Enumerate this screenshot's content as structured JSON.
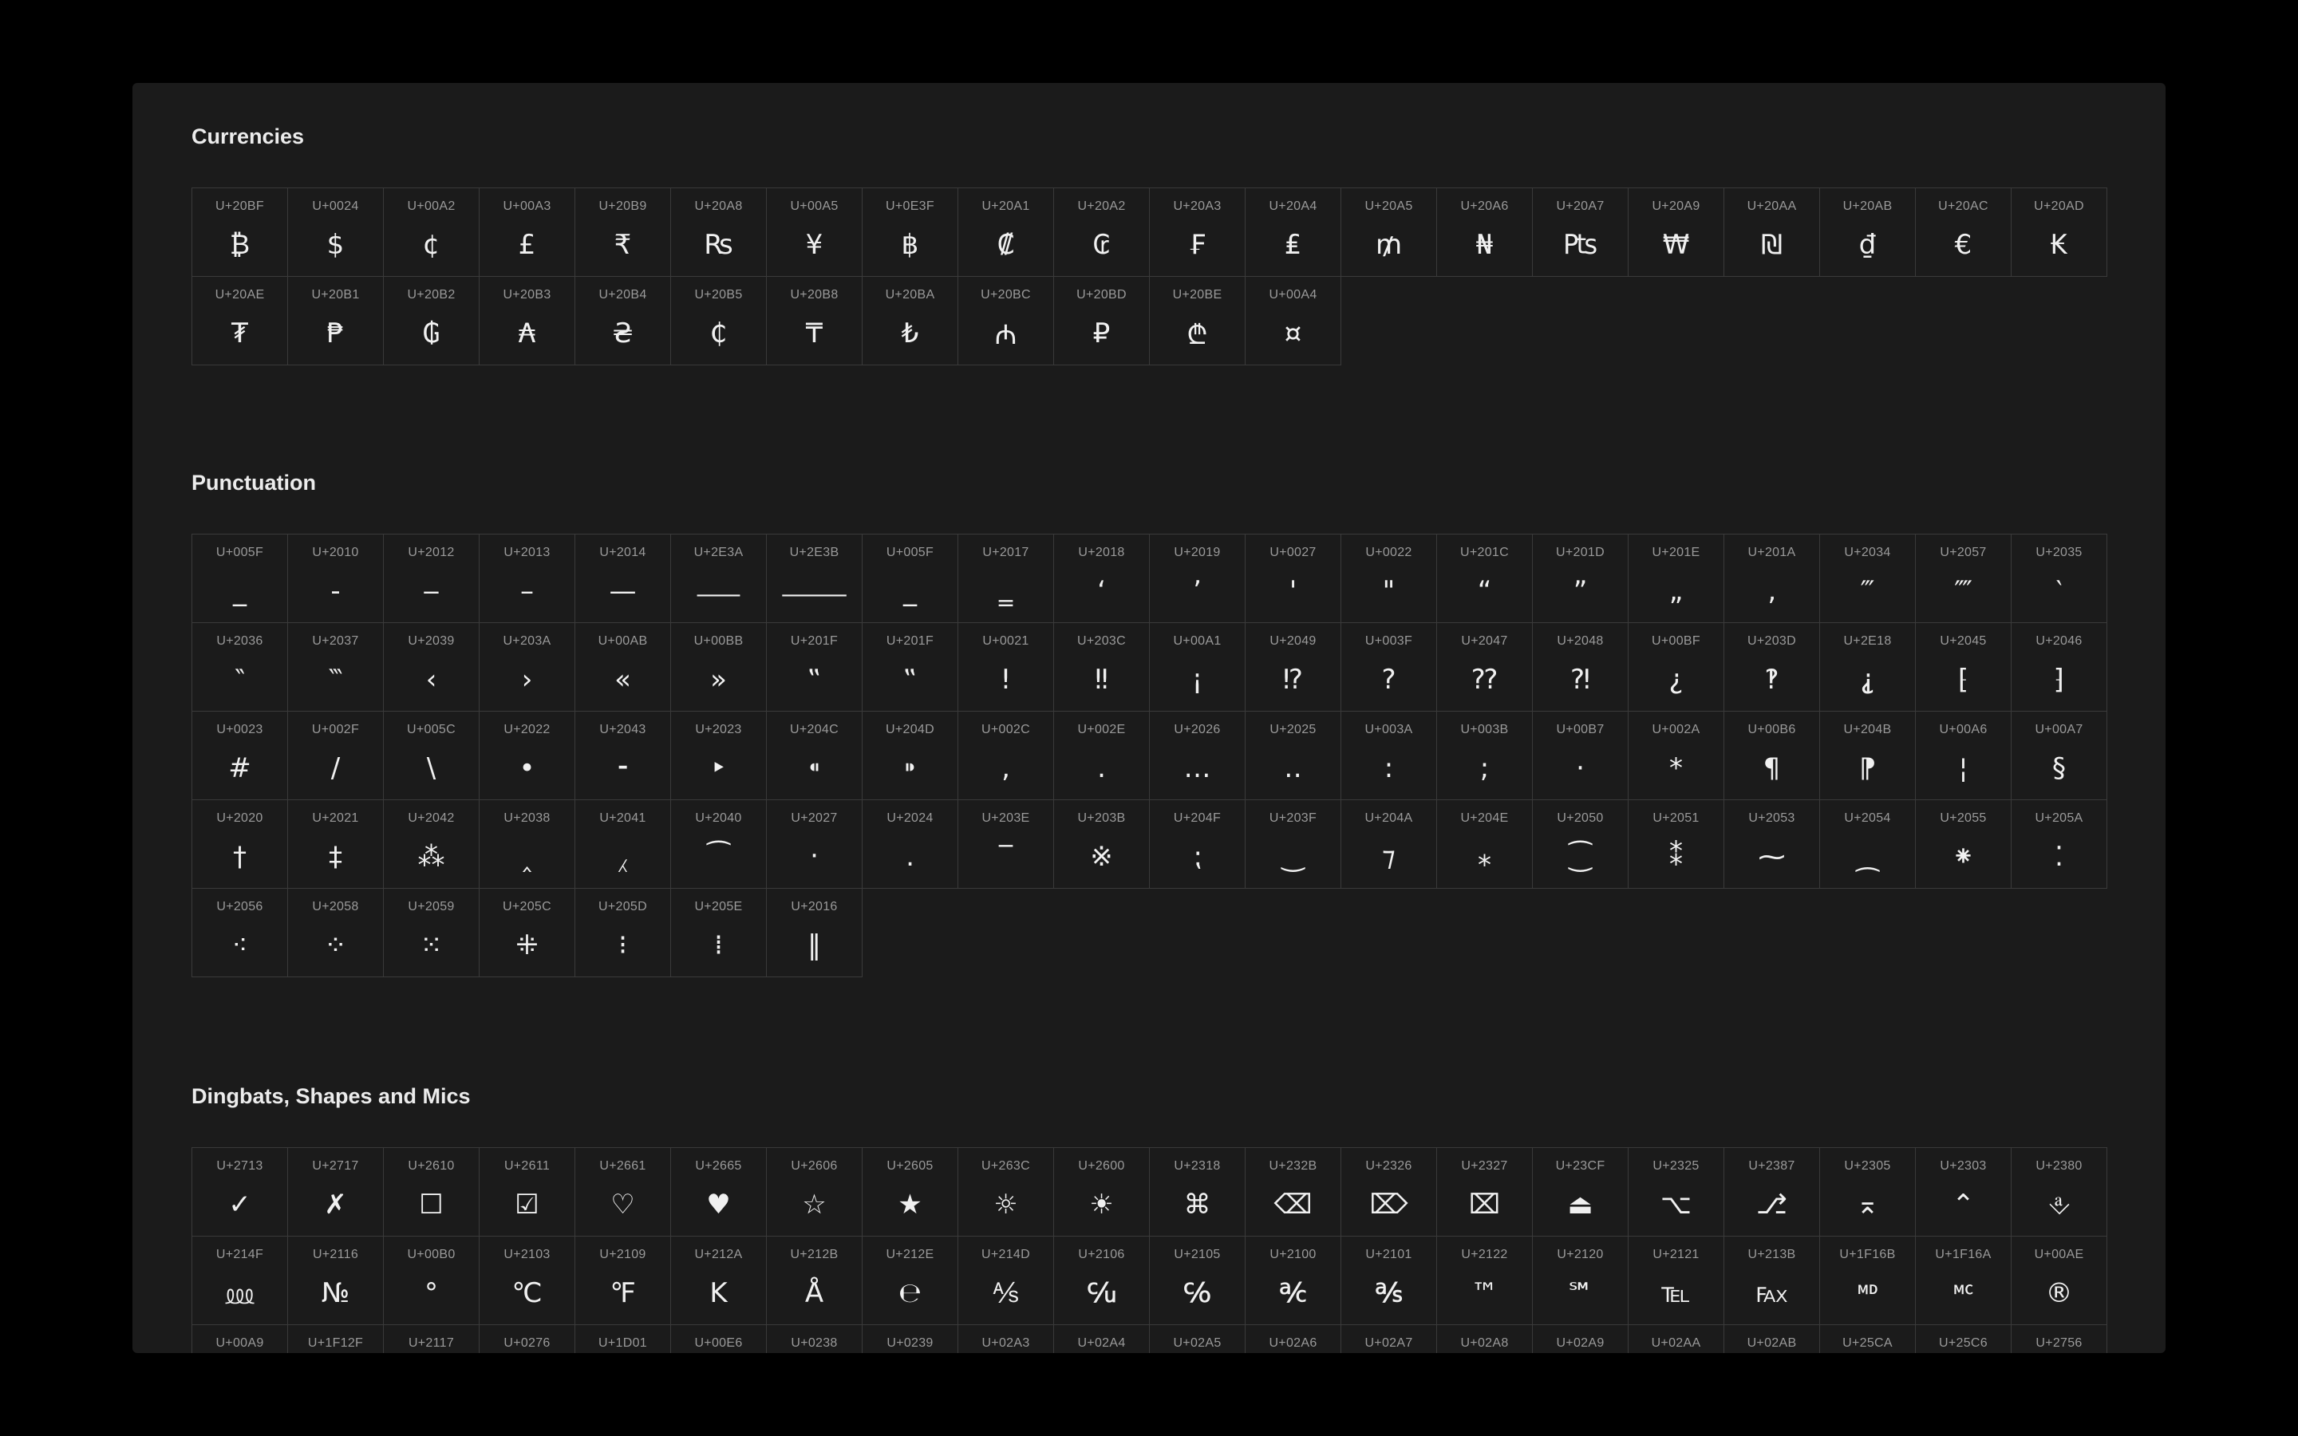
{
  "sections": [
    {
      "title": "Currencies",
      "glyphs": [
        {
          "code": "U+20BF",
          "char": "₿"
        },
        {
          "code": "U+0024",
          "char": "$"
        },
        {
          "code": "U+00A2",
          "char": "¢"
        },
        {
          "code": "U+00A3",
          "char": "£"
        },
        {
          "code": "U+20B9",
          "char": "₹"
        },
        {
          "code": "U+20A8",
          "char": "₨"
        },
        {
          "code": "U+00A5",
          "char": "¥"
        },
        {
          "code": "U+0E3F",
          "char": "฿"
        },
        {
          "code": "U+20A1",
          "char": "₡"
        },
        {
          "code": "U+20A2",
          "char": "₢"
        },
        {
          "code": "U+20A3",
          "char": "₣"
        },
        {
          "code": "U+20A4",
          "char": "₤"
        },
        {
          "code": "U+20A5",
          "char": "₥"
        },
        {
          "code": "U+20A6",
          "char": "₦"
        },
        {
          "code": "U+20A7",
          "char": "₧"
        },
        {
          "code": "U+20A9",
          "char": "₩"
        },
        {
          "code": "U+20AA",
          "char": "₪"
        },
        {
          "code": "U+20AB",
          "char": "₫"
        },
        {
          "code": "U+20AC",
          "char": "€"
        },
        {
          "code": "U+20AD",
          "char": "₭"
        },
        {
          "code": "U+20AE",
          "char": "₮"
        },
        {
          "code": "U+20B1",
          "char": "₱"
        },
        {
          "code": "U+20B2",
          "char": "₲"
        },
        {
          "code": "U+20B3",
          "char": "₳"
        },
        {
          "code": "U+20B4",
          "char": "₴"
        },
        {
          "code": "U+20B5",
          "char": "₵"
        },
        {
          "code": "U+20B8",
          "char": "₸"
        },
        {
          "code": "U+20BA",
          "char": "₺"
        },
        {
          "code": "U+20BC",
          "char": "₼"
        },
        {
          "code": "U+20BD",
          "char": "₽"
        },
        {
          "code": "U+20BE",
          "char": "₾"
        },
        {
          "code": "U+00A4",
          "char": "¤"
        }
      ]
    },
    {
      "title": "Punctuation",
      "glyphs": [
        {
          "code": "U+005F",
          "char": "_"
        },
        {
          "code": "U+2010",
          "char": "‐"
        },
        {
          "code": "U+2012",
          "char": "‒"
        },
        {
          "code": "U+2013",
          "char": "–"
        },
        {
          "code": "U+2014",
          "char": "—"
        },
        {
          "code": "U+2E3A",
          "char": "⸺"
        },
        {
          "code": "U+2E3B",
          "char": "⸻"
        },
        {
          "code": "U+005F",
          "char": "_"
        },
        {
          "code": "U+2017",
          "char": "‗"
        },
        {
          "code": "U+2018",
          "char": "‘"
        },
        {
          "code": "U+2019",
          "char": "’"
        },
        {
          "code": "U+0027",
          "char": "'"
        },
        {
          "code": "U+0022",
          "char": "\""
        },
        {
          "code": "U+201C",
          "char": "“"
        },
        {
          "code": "U+201D",
          "char": "”"
        },
        {
          "code": "U+201E",
          "char": "„"
        },
        {
          "code": "U+201A",
          "char": "‚"
        },
        {
          "code": "U+2034",
          "char": "‴"
        },
        {
          "code": "U+2057",
          "char": "⁗"
        },
        {
          "code": "U+2035",
          "char": "‵"
        },
        {
          "code": "U+2036",
          "char": "‶"
        },
        {
          "code": "U+2037",
          "char": "‷"
        },
        {
          "code": "U+2039",
          "char": "‹"
        },
        {
          "code": "U+203A",
          "char": "›"
        },
        {
          "code": "U+00AB",
          "char": "«"
        },
        {
          "code": "U+00BB",
          "char": "»"
        },
        {
          "code": "U+201F",
          "char": "‟"
        },
        {
          "code": "U+201F",
          "char": "‟"
        },
        {
          "code": "U+0021",
          "char": "!"
        },
        {
          "code": "U+203C",
          "char": "‼"
        },
        {
          "code": "U+00A1",
          "char": "¡"
        },
        {
          "code": "U+2049",
          "char": "⁉"
        },
        {
          "code": "U+003F",
          "char": "?"
        },
        {
          "code": "U+2047",
          "char": "⁇"
        },
        {
          "code": "U+2048",
          "char": "⁈"
        },
        {
          "code": "U+00BF",
          "char": "¿"
        },
        {
          "code": "U+203D",
          "char": "‽"
        },
        {
          "code": "U+2E18",
          "char": "⸘"
        },
        {
          "code": "U+2045",
          "char": "⁅"
        },
        {
          "code": "U+2046",
          "char": "⁆"
        },
        {
          "code": "U+0023",
          "char": "#"
        },
        {
          "code": "U+002F",
          "char": "/"
        },
        {
          "code": "U+005C",
          "char": "\\"
        },
        {
          "code": "U+2022",
          "char": "•"
        },
        {
          "code": "U+2043",
          "char": "⁃"
        },
        {
          "code": "U+2023",
          "char": "‣"
        },
        {
          "code": "U+204C",
          "char": "⁌"
        },
        {
          "code": "U+204D",
          "char": "⁍"
        },
        {
          "code": "U+002C",
          "char": ","
        },
        {
          "code": "U+002E",
          "char": "."
        },
        {
          "code": "U+2026",
          "char": "…"
        },
        {
          "code": "U+2025",
          "char": "‥"
        },
        {
          "code": "U+003A",
          "char": ":"
        },
        {
          "code": "U+003B",
          "char": ";"
        },
        {
          "code": "U+00B7",
          "char": "·"
        },
        {
          "code": "U+002A",
          "char": "*"
        },
        {
          "code": "U+00B6",
          "char": "¶"
        },
        {
          "code": "U+204B",
          "char": "⁋"
        },
        {
          "code": "U+00A6",
          "char": "¦"
        },
        {
          "code": "U+00A7",
          "char": "§"
        },
        {
          "code": "U+2020",
          "char": "†"
        },
        {
          "code": "U+2021",
          "char": "‡"
        },
        {
          "code": "U+2042",
          "char": "⁂"
        },
        {
          "code": "U+2038",
          "char": "‸"
        },
        {
          "code": "U+2041",
          "char": "⁁"
        },
        {
          "code": "U+2040",
          "char": "⁀"
        },
        {
          "code": "U+2027",
          "char": "‧"
        },
        {
          "code": "U+2024",
          "char": "․"
        },
        {
          "code": "U+203E",
          "char": "‾"
        },
        {
          "code": "U+203B",
          "char": "※"
        },
        {
          "code": "U+204F",
          "char": "⁏"
        },
        {
          "code": "U+203F",
          "char": "‿"
        },
        {
          "code": "U+204A",
          "char": "⁊"
        },
        {
          "code": "U+204E",
          "char": "⁎"
        },
        {
          "code": "U+2050",
          "char": "⁐"
        },
        {
          "code": "U+2051",
          "char": "⁑"
        },
        {
          "code": "U+2053",
          "char": "⁓"
        },
        {
          "code": "U+2054",
          "char": "⁔"
        },
        {
          "code": "U+2055",
          "char": "⁕"
        },
        {
          "code": "U+205A",
          "char": "⁚"
        },
        {
          "code": "U+2056",
          "char": "⁖"
        },
        {
          "code": "U+2058",
          "char": "⁘"
        },
        {
          "code": "U+2059",
          "char": "⁙"
        },
        {
          "code": "U+205C",
          "char": "⁜"
        },
        {
          "code": "U+205D",
          "char": "⁝"
        },
        {
          "code": "U+205E",
          "char": "⁞"
        },
        {
          "code": "U+2016",
          "char": "‖"
        }
      ]
    },
    {
      "title": "Dingbats, Shapes and Mics",
      "glyphs": [
        {
          "code": "U+2713",
          "char": "✓"
        },
        {
          "code": "U+2717",
          "char": "✗"
        },
        {
          "code": "U+2610",
          "char": "☐"
        },
        {
          "code": "U+2611",
          "char": "☑"
        },
        {
          "code": "U+2661",
          "char": "♡"
        },
        {
          "code": "U+2665",
          "char": "♥"
        },
        {
          "code": "U+2606",
          "char": "☆"
        },
        {
          "code": "U+2605",
          "char": "★"
        },
        {
          "code": "U+263C",
          "char": "☼"
        },
        {
          "code": "U+2600",
          "char": "☀"
        },
        {
          "code": "U+2318",
          "char": "⌘"
        },
        {
          "code": "U+232B",
          "char": "⌫"
        },
        {
          "code": "U+2326",
          "char": "⌦"
        },
        {
          "code": "U+2327",
          "char": "⌧"
        },
        {
          "code": "U+23CF",
          "char": "⏏"
        },
        {
          "code": "U+2325",
          "char": "⌥"
        },
        {
          "code": "U+2387",
          "char": "⎇"
        },
        {
          "code": "U+2305",
          "char": "⌅"
        },
        {
          "code": "U+2303",
          "char": "⌃"
        },
        {
          "code": "U+2380",
          "char": "⎀"
        },
        {
          "code": "U+214F",
          "char": "⅏"
        },
        {
          "code": "U+2116",
          "char": "№"
        },
        {
          "code": "U+00B0",
          "char": "°"
        },
        {
          "code": "U+2103",
          "char": "℃"
        },
        {
          "code": "U+2109",
          "char": "℉"
        },
        {
          "code": "U+212A",
          "char": "K"
        },
        {
          "code": "U+212B",
          "char": "Å"
        },
        {
          "code": "U+212E",
          "char": "℮"
        },
        {
          "code": "U+214D",
          "char": "⅍"
        },
        {
          "code": "U+2106",
          "char": "℆"
        },
        {
          "code": "U+2105",
          "char": "℅"
        },
        {
          "code": "U+2100",
          "char": "℀"
        },
        {
          "code": "U+2101",
          "char": "℁"
        },
        {
          "code": "U+2122",
          "char": "™"
        },
        {
          "code": "U+2120",
          "char": "℠"
        },
        {
          "code": "U+2121",
          "char": "℡"
        },
        {
          "code": "U+213B",
          "char": "℻"
        },
        {
          "code": "U+1F16B",
          "char": "🅫"
        },
        {
          "code": "U+1F16A",
          "char": "🅪"
        },
        {
          "code": "U+00AE",
          "char": "®"
        },
        {
          "code": "U+00A9",
          "char": ""
        },
        {
          "code": "U+1F12F",
          "char": ""
        },
        {
          "code": "U+2117",
          "char": ""
        },
        {
          "code": "U+0276",
          "char": ""
        },
        {
          "code": "U+1D01",
          "char": ""
        },
        {
          "code": "U+00E6",
          "char": ""
        },
        {
          "code": "U+0238",
          "char": ""
        },
        {
          "code": "U+0239",
          "char": ""
        },
        {
          "code": "U+02A3",
          "char": ""
        },
        {
          "code": "U+02A4",
          "char": ""
        },
        {
          "code": "U+02A5",
          "char": ""
        },
        {
          "code": "U+02A6",
          "char": ""
        },
        {
          "code": "U+02A7",
          "char": ""
        },
        {
          "code": "U+02A8",
          "char": ""
        },
        {
          "code": "U+02A9",
          "char": ""
        },
        {
          "code": "U+02AA",
          "char": ""
        },
        {
          "code": "U+02AB",
          "char": ""
        },
        {
          "code": "U+25CA",
          "char": ""
        },
        {
          "code": "U+25C6",
          "char": ""
        },
        {
          "code": "U+2756",
          "char": ""
        }
      ]
    }
  ]
}
